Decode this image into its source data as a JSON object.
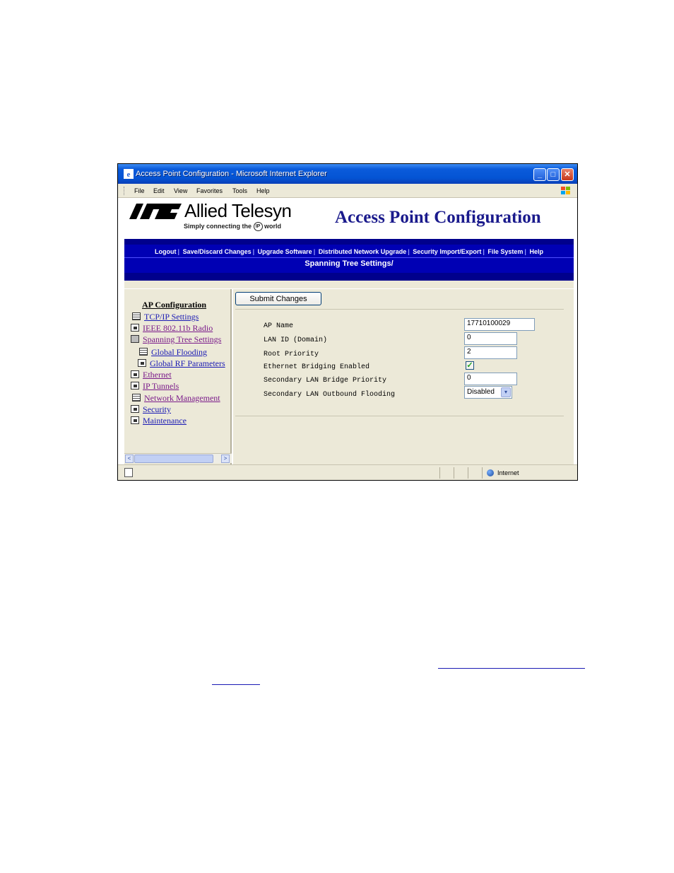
{
  "window": {
    "title": "Access Point Configuration - Microsoft Internet Explorer",
    "controls": {
      "minimize": "_",
      "maximize": "□",
      "close": "✕"
    }
  },
  "menubar": {
    "items": [
      "File",
      "Edit",
      "View",
      "Favorites",
      "Tools",
      "Help"
    ]
  },
  "header": {
    "brand": "Allied Telesyn",
    "tagline_before": "Simply connecting the",
    "tagline_ip": "IP",
    "tagline_after": "world",
    "app_title": "Access Point Configuration"
  },
  "nav": {
    "links": [
      "Logout",
      "Save/Discard Changes",
      "Upgrade Software",
      "Distributed Network Upgrade",
      "Security Import/Export",
      "File System",
      "Help"
    ],
    "breadcrumb": "Spanning Tree Settings/"
  },
  "sidebar": {
    "heading": "AP Configuration",
    "items": [
      {
        "label": "TCP/IP Settings",
        "icon": "doc"
      },
      {
        "label": "IEEE 802.11b Radio",
        "icon": "folder"
      },
      {
        "label": "Spanning Tree Settings",
        "icon": "open-folder"
      },
      {
        "label": "Global Flooding",
        "icon": "doc"
      },
      {
        "label": "Global RF Parameters",
        "icon": "folder"
      },
      {
        "label": "Ethernet",
        "icon": "folder"
      },
      {
        "label": "IP Tunnels",
        "icon": "folder"
      },
      {
        "label": "Network Management",
        "icon": "doc"
      },
      {
        "label": "Security",
        "icon": "folder"
      },
      {
        "label": "Maintenance",
        "icon": "folder"
      }
    ],
    "scroll_left": "<",
    "scroll_right": ">"
  },
  "form": {
    "submit_label": "Submit Changes",
    "fields": {
      "ap_name": {
        "label": "AP Name",
        "value": "17710100029"
      },
      "lan_id": {
        "label": "LAN ID (Domain)",
        "value": "0"
      },
      "root_priority": {
        "label": "Root Priority",
        "value": "2"
      },
      "ethernet_bridging": {
        "label": "Ethernet Bridging Enabled",
        "checked": "✓"
      },
      "secondary_bridge_priority": {
        "label": "Secondary LAN Bridge Priority",
        "value": "0"
      },
      "secondary_outbound_flooding": {
        "label": "Secondary LAN Outbound Flooding",
        "value": "Disabled",
        "arrow": "▾"
      }
    }
  },
  "statusbar": {
    "zone": "Internet"
  },
  "colors": {
    "nav_blue": "#0000b4",
    "title_blue": "#1a1a8c",
    "link_blue": "#1a1ab4",
    "visited": "#7a1a8a",
    "pane_bg": "#ece9d8"
  }
}
